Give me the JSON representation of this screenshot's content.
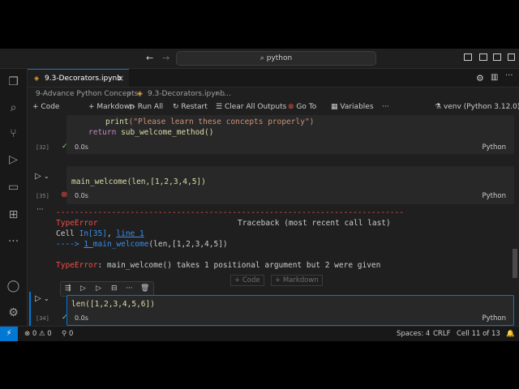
{
  "titlebar": {
    "back": "←",
    "forward": "→",
    "search_placeholder": "python",
    "search_icon": "search-icon"
  },
  "tabs": [
    {
      "label": "9.3-Decorators.ipynb",
      "close": "×"
    }
  ],
  "breadcrumb": {
    "folder": "9-Advance Python Concepts",
    "sep": "›",
    "file": "9.3-Decorators.ipynb",
    "more": "…"
  },
  "toolbar": {
    "code": "Code",
    "markdown": "Markdown",
    "run_all": "Run All",
    "restart": "Restart",
    "clear_all": "Clear All Outputs",
    "goto": "Go To",
    "variables": "Variables",
    "more": "···",
    "kernel": "venv (Python 3.12.0)"
  },
  "cells": [
    {
      "exec": "[32]",
      "time": "0.0s",
      "lang": "Python"
    },
    {
      "exec": "[35]",
      "code": "main_welcome(len,[1,2,3,4,5])",
      "time": "0.0s",
      "lang": "Python"
    },
    {
      "exec": "[34]",
      "code": "len([1,2,3,4,5,6])",
      "time": "0.0s",
      "lang": "Python"
    }
  ],
  "code_top": {
    "line1_fn": "print",
    "line1_str": "(\"Please learn these concepts properly\")",
    "line2_kw": "return",
    "line2_rest": "sub_welcome_method()"
  },
  "error": {
    "dashes": "---------------------------------------------------------------------------",
    "type": "TypeError",
    "traceback": "Traceback (most recent call last)",
    "cell_label": "Cell ",
    "cell_in": "In[35]",
    "comma": ", ",
    "line": "line 1",
    "arrow": "----> ",
    "arrow_num": "1 ",
    "arrow_fn": "main_welcome",
    "arrow_rest": "(len,[1,2,3,4,5])",
    "final_type": "TypeError",
    "final_msg": ": main_welcome() takes 1 positional argument but 2 were given"
  },
  "add_cell": {
    "code": "+ Code",
    "markdown": "+ Markdown"
  },
  "output_more": "···",
  "statusbar": {
    "errors": "0",
    "warnings": "0",
    "ports": "0",
    "spaces": "Spaces: 4",
    "eol": "CRLF",
    "cell": "Cell 11 of 13",
    "bell": "🔔"
  },
  "colors": {
    "accent": "#0078d4",
    "error": "#f14c4c",
    "editor_bg": "#1f1f1f"
  }
}
